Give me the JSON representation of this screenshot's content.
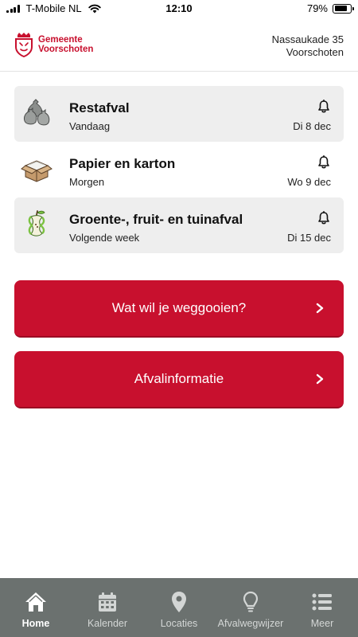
{
  "status_bar": {
    "carrier": "T-Mobile NL",
    "time": "12:10",
    "battery_percent": "79%",
    "battery_level": 0.79
  },
  "header": {
    "logo_line1": "Gemeente",
    "logo_line2": "Voorschoten",
    "address_line1": "Nassaukade 35",
    "address_line2": "Voorschoten"
  },
  "collections": [
    {
      "title": "Restafval",
      "when": "Vandaag",
      "date": "Di 8 dec",
      "icon": "trash-bags-icon"
    },
    {
      "title": "Papier en karton",
      "when": "Morgen",
      "date": "Wo 9 dec",
      "icon": "cardboard-box-icon"
    },
    {
      "title": "Groente-, fruit- en tuinafval",
      "when": "Volgende week",
      "date": "Di 15 dec",
      "icon": "apple-core-icon"
    }
  ],
  "actions": {
    "what_to_throw": "Wat wil je weggooien?",
    "waste_info": "Afvalinformatie"
  },
  "tabs": [
    {
      "label": "Home",
      "icon": "home-icon",
      "active": true
    },
    {
      "label": "Kalender",
      "icon": "calendar-icon",
      "active": false
    },
    {
      "label": "Locaties",
      "icon": "location-pin-icon",
      "active": false
    },
    {
      "label": "Afvalwegwijzer",
      "icon": "lightbulb-icon",
      "active": false
    },
    {
      "label": "Meer",
      "icon": "menu-list-icon",
      "active": false
    }
  ],
  "colors": {
    "brand_red": "#c8102e",
    "tabbar_bg": "#6b716f",
    "card_shade": "#eeeeee"
  }
}
